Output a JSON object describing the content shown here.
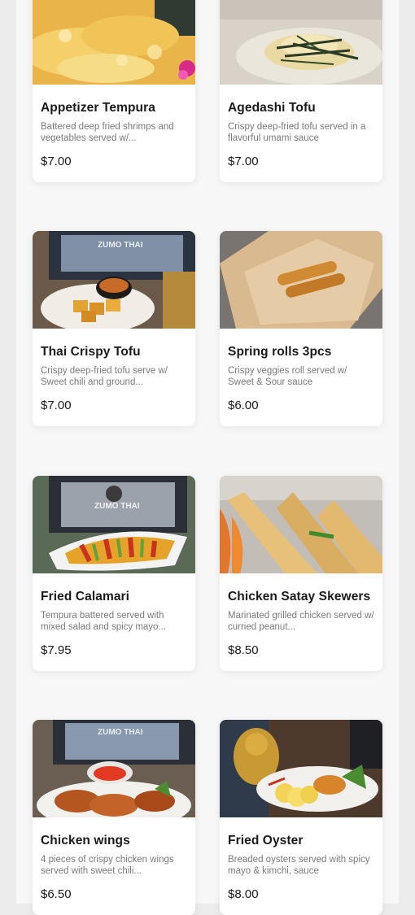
{
  "menu": {
    "items": [
      {
        "name": "Appetizer Tempura",
        "description": "Battered deep fried shrimps and vegetables served w/...",
        "price": "$7.00",
        "image_icon": "tempura-photo"
      },
      {
        "name": "Agedashi Tofu",
        "description": "Crispy deep-fried tofu served in a flavorful umami sauce",
        "price": "$7.00",
        "image_icon": "agedashi-tofu-photo"
      },
      {
        "name": "Thai Crispy Tofu",
        "description": "Crispy deep-fried tofu serve w/ Sweet chili and ground...",
        "price": "$7.00",
        "image_icon": "crispy-tofu-photo"
      },
      {
        "name": "Spring rolls 3pcs",
        "description": "Crispy veggies roll served w/ Sweet & Sour sauce",
        "price": "$6.00",
        "image_icon": "spring-rolls-photo"
      },
      {
        "name": "Fried Calamari",
        "description": "Tempura battered served with mixed salad and spicy mayo...",
        "price": "$7.95",
        "image_icon": "calamari-photo"
      },
      {
        "name": "Chicken Satay Skewers",
        "description": "Marinated grilled chicken served w/ curried peanut...",
        "price": "$8.50",
        "image_icon": "satay-photo"
      },
      {
        "name": "Chicken wings",
        "description": "4 pieces of crispy chicken wings served with sweet chili...",
        "price": "$6.50",
        "image_icon": "chicken-wings-photo"
      },
      {
        "name": "Fried Oyster",
        "description": "Breaded oysters served with spicy mayo & kimchi, sauce",
        "price": "$8.00",
        "image_icon": "fried-oyster-photo"
      }
    ],
    "photo_sign_text": "ZUMO THAI"
  }
}
